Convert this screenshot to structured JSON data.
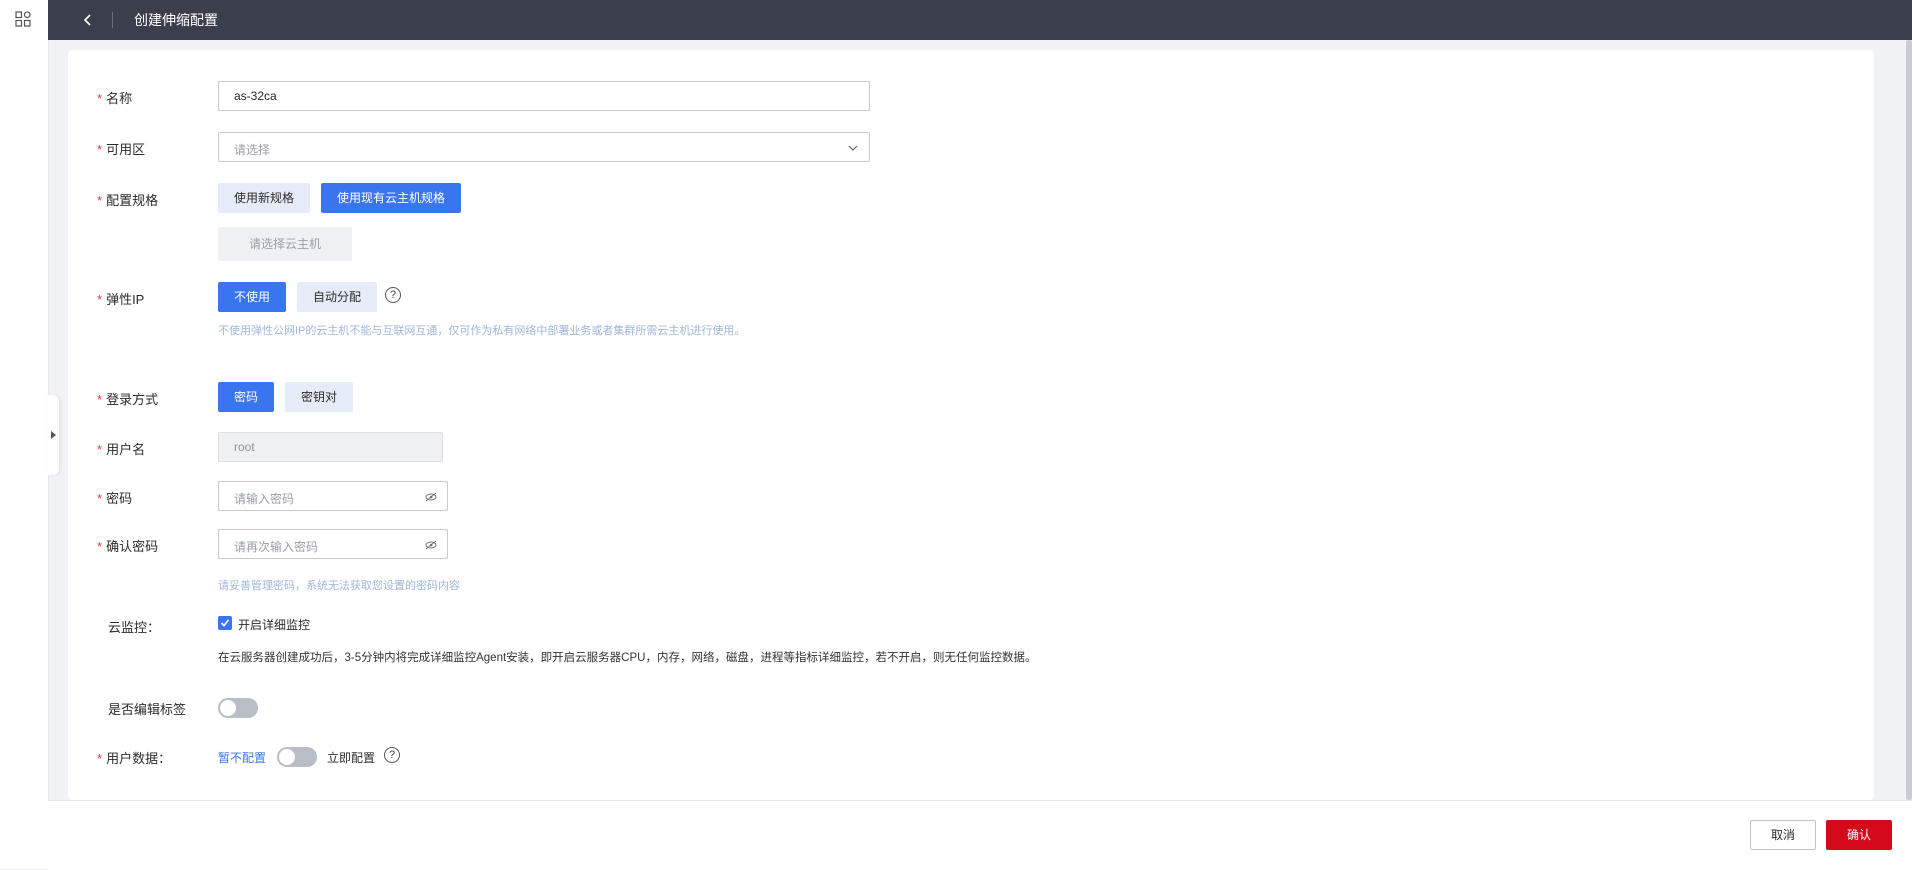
{
  "header": {
    "title": "创建伸缩配置",
    "back_icon": "chevron-left-icon"
  },
  "sidebar": {
    "apps_icon": "grid-apps-icon"
  },
  "form": {
    "name": {
      "label": "名称",
      "value": "as-32ca"
    },
    "zone": {
      "label": "可用区",
      "placeholder": "请选择"
    },
    "spec": {
      "label": "配置规格",
      "options": [
        "使用新规格",
        "使用现有云主机规格"
      ],
      "selected": "使用现有云主机规格",
      "select_host_button": "请选择云主机"
    },
    "eip": {
      "label": "弹性IP",
      "options": [
        "不使用",
        "自动分配"
      ],
      "selected": "不使用",
      "hint": "不使用弹性公网IP的云主机不能与互联网互通，仅可作为私有网络中部署业务或者集群所需云主机进行使用。"
    },
    "login": {
      "label": "登录方式",
      "options": [
        "密码",
        "密钥对"
      ],
      "selected": "密码"
    },
    "username": {
      "label": "用户名",
      "value": "root"
    },
    "password": {
      "label": "密码",
      "placeholder": "请输入密码"
    },
    "confirm_password": {
      "label": "确认密码",
      "placeholder": "请再次输入密码",
      "hint": "请妥善管理密码，系统无法获取您设置的密码内容"
    },
    "monitor": {
      "label": "云监控：",
      "checkbox_label": "开启详细监控",
      "checked": true,
      "desc": "在云服务器创建成功后，3-5分钟内将完成详细监控Agent安装，即开启云服务器CPU，内存，网络，磁盘，进程等指标详细监控，若不开启，则无任何监控数据。"
    },
    "tags": {
      "label": "是否编辑标签",
      "enabled": false
    },
    "userdata": {
      "label": "用户数据：",
      "off_label": "暂不配置",
      "on_label": "立即配置",
      "enabled": false
    }
  },
  "footer": {
    "cancel": "取消",
    "confirm": "确认"
  },
  "colors": {
    "primary": "#3a75f0",
    "danger": "#d4091b",
    "topbar": "#3a3f4b",
    "required": "#e8393d"
  }
}
